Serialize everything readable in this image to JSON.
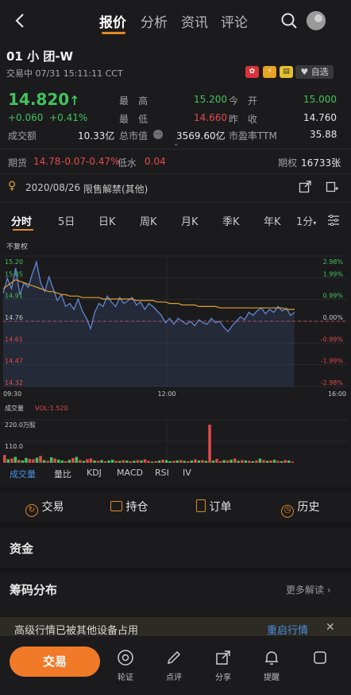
{
  "header": {
    "back_icon": "chevron-left-icon",
    "tabs": [
      {
        "label": "报价",
        "active": true
      },
      {
        "label": "分析",
        "active": false
      },
      {
        "label": "资讯",
        "active": false
      },
      {
        "label": "评论",
        "active": false
      }
    ],
    "search_icon": "search-icon",
    "avatar_icon": "avatar-icon"
  },
  "stock": {
    "name": "01  小  团-W",
    "status": "交易中 07/31 15:11:11 CCT",
    "watch_label": "自选",
    "price": "14.820",
    "change": "+0.060",
    "change_pct": "+0.41%",
    "high_label": "最　高",
    "high": "15.200",
    "open_label": "今　开",
    "open": "15.000",
    "low_label": "最　低",
    "low": "14.660",
    "prev_label": "昨　收",
    "prev": "14.760",
    "turnover_label": "成交额",
    "turnover": "10.33亿",
    "mcap_label": "总市值",
    "mcap": "3569.60亿",
    "pe_label": "市盈率TTM",
    "pe": "35.88"
  },
  "futures": {
    "label": "期货",
    "price": "14.78",
    "change": "-0.07",
    "pct": "-0.47%",
    "disc_label": "低水",
    "disc": "0.04",
    "options_label": "期权",
    "options": "16733张"
  },
  "notice": {
    "date": "2020/08/26",
    "text": "限售解禁(其他)"
  },
  "periods": [
    "分时",
    "5日",
    "日K",
    "周K",
    "月K",
    "季K",
    "年K",
    "1分"
  ],
  "chart_data": {
    "type": "line",
    "adjust_label": "不复权",
    "y_ticks_left": [
      "15.20",
      "15.05",
      "14.91",
      "14.76",
      "14.61",
      "14.47",
      "14.32"
    ],
    "y_ticks_right": [
      "2.98%",
      "1.99%",
      "0.99%",
      "0.00%",
      "-0.99%",
      "-1.99%",
      "-2.98%"
    ],
    "x_ticks": [
      "09:30",
      "12:00",
      "16:00"
    ],
    "ylim": [
      14.32,
      15.2
    ],
    "prev_close": 14.76,
    "series": [
      {
        "values": [
          14.95,
          15.05,
          14.98,
          15.12,
          14.94,
          15.02,
          14.99,
          15.08,
          15.16,
          15.02,
          14.96,
          15.06,
          14.98,
          14.9,
          14.94,
          14.86,
          14.88,
          14.84,
          14.91,
          14.83,
          14.78,
          14.71,
          14.82,
          14.88,
          14.86,
          14.93,
          14.89,
          14.86,
          14.92,
          14.88,
          14.9,
          14.92,
          14.87,
          14.89,
          14.84,
          14.88,
          14.86,
          14.83,
          14.8,
          14.75,
          14.78,
          14.74,
          14.78,
          14.76,
          14.74,
          14.76,
          14.73,
          14.77,
          14.75,
          14.74,
          14.78,
          14.75,
          14.76,
          14.72,
          14.69,
          14.73,
          14.76,
          14.79,
          14.77,
          14.82,
          14.8,
          14.83,
          14.85,
          14.81,
          14.84,
          14.82,
          14.86,
          14.83,
          14.85,
          14.8,
          14.82
        ]
      },
      {
        "values": [
          14.98,
          15.0,
          15.02,
          15.04,
          15.03,
          15.02,
          15.01,
          15.0,
          14.99,
          14.98,
          14.97,
          14.96,
          14.96,
          14.95,
          14.94,
          14.94,
          14.93,
          14.93,
          14.93,
          14.92,
          14.92,
          14.92,
          14.92,
          14.92,
          14.91,
          14.91,
          14.91,
          14.91,
          14.91,
          14.91,
          14.91,
          14.91,
          14.9,
          14.9,
          14.9,
          14.9,
          14.9,
          14.89,
          14.89,
          14.89,
          14.88,
          14.88,
          14.88,
          14.87,
          14.87,
          14.87,
          14.87,
          14.86,
          14.86,
          14.86,
          14.86,
          14.86,
          14.85,
          14.85,
          14.85,
          14.85,
          14.85,
          14.85,
          14.85,
          14.85,
          14.85,
          14.85,
          14.85,
          14.85,
          14.85,
          14.85,
          14.85,
          14.85,
          14.84,
          14.84,
          14.84
        ]
      }
    ],
    "volume": {
      "label": "成交量",
      "vol_label": "VOL:1.520",
      "ticks": [
        "220.0万股",
        "110.0"
      ],
      "ylim": [
        0,
        220
      ],
      "values": [
        40,
        18,
        22,
        30,
        15,
        12,
        25,
        20,
        18,
        26,
        35,
        14,
        10,
        28,
        22,
        16,
        12,
        8,
        15,
        24,
        30,
        14,
        10,
        18,
        22,
        12,
        10,
        14,
        8,
        12,
        16,
        10,
        9,
        14,
        12,
        8,
        10,
        14,
        12,
        18,
        10,
        6,
        8,
        12,
        16,
        14,
        8,
        10,
        12,
        14,
        10,
        8,
        12,
        18,
        12,
        14,
        10,
        195,
        12,
        20,
        8,
        14,
        12,
        16,
        22,
        10,
        14,
        12,
        10,
        8,
        12,
        22,
        14,
        10,
        12,
        16,
        10,
        8,
        14,
        12,
        6
      ],
      "colors": [
        "r",
        "g",
        "r",
        "g",
        "r",
        "g",
        "g",
        "r",
        "r",
        "g",
        "r",
        "g",
        "r",
        "g",
        "r",
        "g",
        "g",
        "r",
        "g",
        "r",
        "g",
        "r",
        "g",
        "r",
        "r",
        "g",
        "r",
        "g",
        "r",
        "g",
        "g",
        "r",
        "g",
        "r",
        "g",
        "r",
        "g",
        "r",
        "g",
        "r",
        "r",
        "g",
        "r",
        "g",
        "r",
        "g",
        "g",
        "r",
        "g",
        "r",
        "g",
        "r",
        "g",
        "r",
        "g",
        "r",
        "g",
        "r",
        "g",
        "r",
        "r",
        "g",
        "r",
        "g",
        "r",
        "g",
        "r",
        "g",
        "r",
        "g",
        "r",
        "g",
        "r",
        "g",
        "r",
        "g",
        "r",
        "g",
        "r",
        "g",
        "r"
      ]
    }
  },
  "indicators": [
    "成交量",
    "量比",
    "KDJ",
    "MACD",
    "RSI",
    "IV"
  ],
  "actions": {
    "trade": "交易",
    "position": "持仓",
    "order": "订单",
    "history": "历史"
  },
  "sections": {
    "funds": "资金",
    "chips": "筹码分布",
    "more": "更多解读"
  },
  "banner": {
    "text": "高级行情已被其他设备占用",
    "action": "重启行情"
  },
  "bottom": {
    "trade_button": "交易",
    "items": [
      {
        "label": "轮证"
      },
      {
        "label": "点评"
      },
      {
        "label": "分享"
      },
      {
        "label": "提醒"
      }
    ]
  },
  "colors": {
    "accent": "#e08a22",
    "up": "#e34a4a",
    "down": "#44c25d",
    "line": "#5f86d6",
    "avg": "#e0a030",
    "link": "#4a8fe0"
  }
}
